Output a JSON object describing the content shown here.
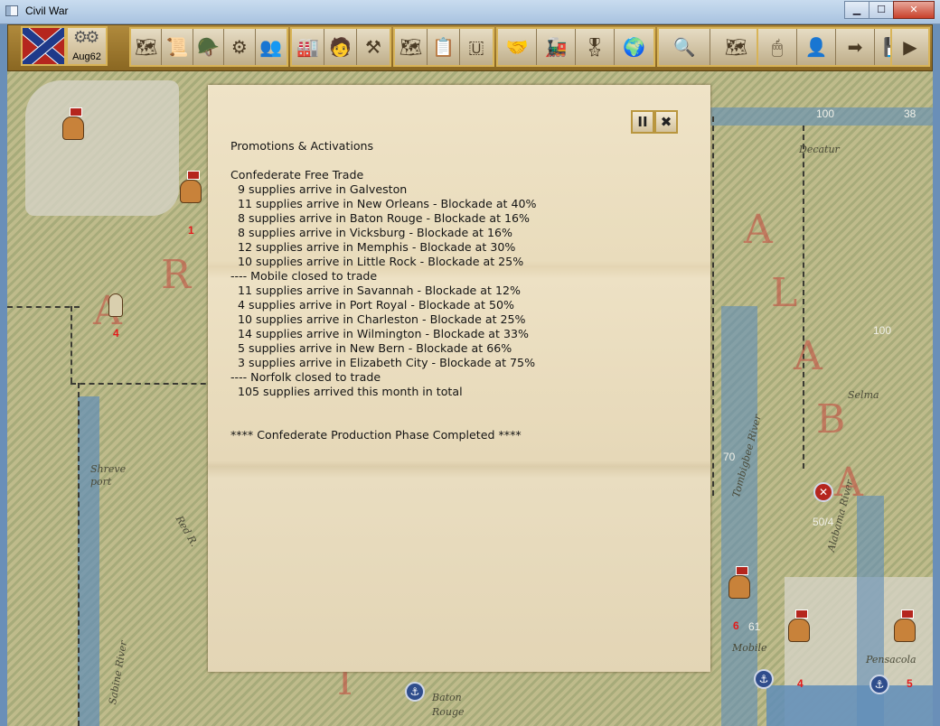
{
  "window": {
    "title": "Civil War",
    "min_label": "▁",
    "max_label": "☐",
    "close_label": "✕"
  },
  "toolbar": {
    "date": "Aug62",
    "groups": [
      {
        "buttons": [
          "🗺",
          "📜",
          "🪖",
          "⚙",
          "👥"
        ]
      },
      {
        "buttons": [
          "🏭",
          "🧑",
          "⚒"
        ]
      },
      {
        "buttons": [
          "🗺",
          "📋",
          "🇺"
        ]
      },
      {
        "buttons": [
          "🤝",
          "🚂",
          "🎖",
          "🌍"
        ]
      },
      {
        "buttons": [
          "🔍",
          "🗺",
          "⏪"
        ]
      },
      {
        "buttons": [
          "🖱",
          "👤",
          "➡",
          "💾"
        ]
      },
      {
        "buttons": [
          "▶"
        ]
      }
    ]
  },
  "map": {
    "labels": [
      {
        "text": "Decatur"
      },
      {
        "text": "Selma"
      },
      {
        "text": "Shreve port"
      },
      {
        "text": "Baton Rouge"
      },
      {
        "text": "Mobile"
      },
      {
        "text": "Tombigbee River"
      },
      {
        "text": "Alabama River"
      },
      {
        "text": "Sabine River"
      },
      {
        "text": "Red R."
      },
      {
        "text": "Pensacola"
      }
    ],
    "numbers": [
      "100",
      "38",
      "100",
      "70",
      "50/4",
      "61"
    ],
    "unit_numbers": [
      "1",
      "4",
      "6",
      "4",
      "5"
    ],
    "state_letters": [
      "A",
      "R",
      "A",
      "L",
      "A",
      "B",
      "A",
      "I"
    ]
  },
  "dialog": {
    "pause_label": "II",
    "close_label": "✖",
    "lines": [
      "Promotions & Activations",
      "",
      "Confederate Free Trade",
      "  9 supplies arrive in Galveston",
      "  11 supplies arrive in New Orleans - Blockade at 40%",
      "  8 supplies arrive in Baton Rouge - Blockade at 16%",
      "  8 supplies arrive in Vicksburg - Blockade at 16%",
      "  12 supplies arrive in Memphis - Blockade at 30%",
      "  10 supplies arrive in Little Rock - Blockade at 25%",
      "---- Mobile closed to trade",
      "  11 supplies arrive in Savannah - Blockade at 12%",
      "  4 supplies arrive in Port Royal - Blockade at 50%",
      "  10 supplies arrive in Charleston - Blockade at 25%",
      "  14 supplies arrive in Wilmington - Blockade at 33%",
      "  5 supplies arrive in New Bern - Blockade at 66%",
      "  3 supplies arrive in Elizabeth City - Blockade at 75%",
      "---- Norfolk closed to trade",
      "  105 supplies arrived this month in total",
      "",
      "",
      "**** Confederate Production Phase Completed ****"
    ]
  }
}
